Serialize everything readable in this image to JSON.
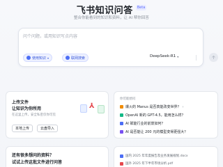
{
  "header": {
    "title": "飞书知识问答",
    "badge": "Beta",
    "subtitle": "整合你能看到的知识和资料，让 AI 帮你回答"
  },
  "ask": {
    "placeholder": "问个问题，或用知识写点内容",
    "chip_kb": "使用知识",
    "chip_web": "联网搜索",
    "model": "DeepSeek-R1"
  },
  "upload": {
    "title_line1": "上传文件",
    "title_line2": "让知识为你所用",
    "desc": "在这里上传，安全私密仅你可见",
    "btn_local": "本地上传",
    "btn_cloud": "云盘导入"
  },
  "hot": {
    "title": "你可能想问",
    "items": [
      "爆火的 Manus 是否真能改变世界？",
      "OpenAI 新的 GPT-4.5，能用怎么样？",
      "AI 赋能行业的前景如何？",
      "AI 是否能让 200 元的模型变得更强大？"
    ]
  },
  "bottom_left": {
    "line1": "还有很多想问的资料？",
    "line2": "试试上传这批文件进行问答"
  },
  "bottom_right": {
    "items": [
      "国内 2025 年年度报告及业务发展规划.docx",
      "国外 2025 年下半年市场分析.pdf"
    ]
  },
  "colors": {
    "accent": "#4c6ef5",
    "pdf_red": "#e5484d",
    "text": "#1f2329",
    "muted": "#8f959e"
  }
}
